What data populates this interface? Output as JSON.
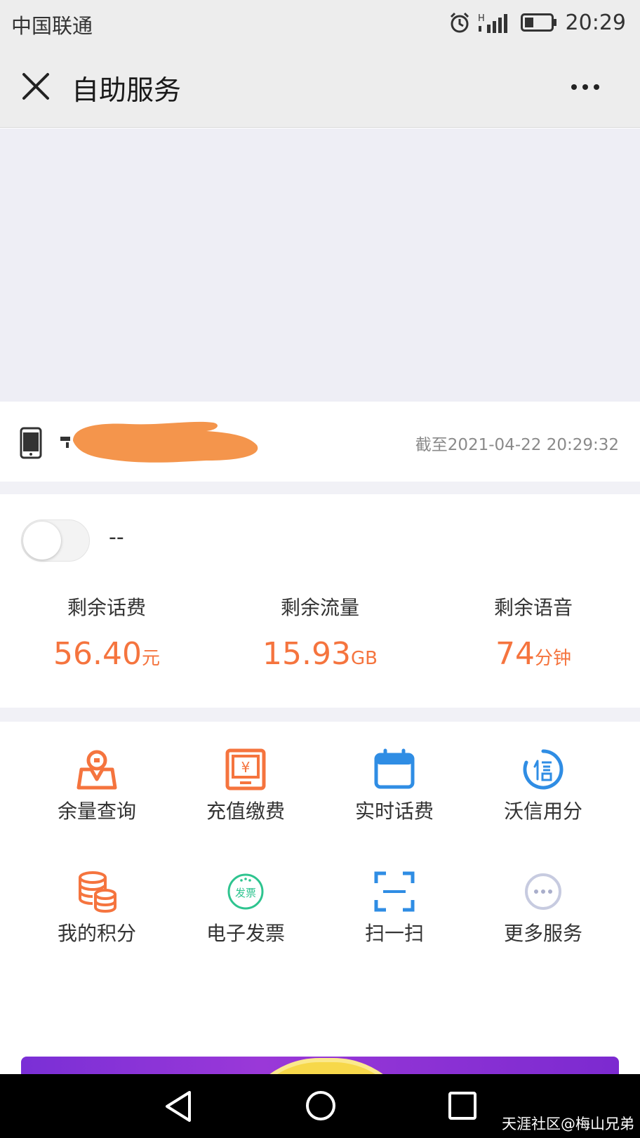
{
  "status_bar": {
    "carrier": "中国联通",
    "time": "20:29",
    "icons": [
      "alarm-icon",
      "signal-icon",
      "battery-icon"
    ]
  },
  "nav": {
    "title": "自助服务",
    "close_icon": "close-icon",
    "more_icon": "more-icon"
  },
  "account": {
    "as_of": "截至2021-04-22 20:29:32"
  },
  "balance": {
    "toggle_label": "--",
    "stats": [
      {
        "label": "剩余话费",
        "value": "56.40",
        "unit": "元"
      },
      {
        "label": "剩余流量",
        "value": "15.93",
        "unit": "GB"
      },
      {
        "label": "剩余语音",
        "value": "74",
        "unit": "分钟"
      }
    ]
  },
  "services": [
    {
      "label": "余量查询",
      "icon": "balance-query-icon"
    },
    {
      "label": "充值缴费",
      "icon": "recharge-icon"
    },
    {
      "label": "实时话费",
      "icon": "calendar-icon"
    },
    {
      "label": "沃信用分",
      "icon": "credit-icon"
    },
    {
      "label": "我的积分",
      "icon": "coins-icon"
    },
    {
      "label": "电子发票",
      "icon": "invoice-icon"
    },
    {
      "label": "扫一扫",
      "icon": "scan-icon"
    },
    {
      "label": "更多服务",
      "icon": "more-services-icon"
    }
  ],
  "colors": {
    "accent_orange": "#f5743e",
    "accent_blue": "#2f8de4",
    "accent_green": "#2ec48f",
    "promo_purple": "#8a35d6"
  },
  "watermark": "天涯社区@梅山兄弟"
}
